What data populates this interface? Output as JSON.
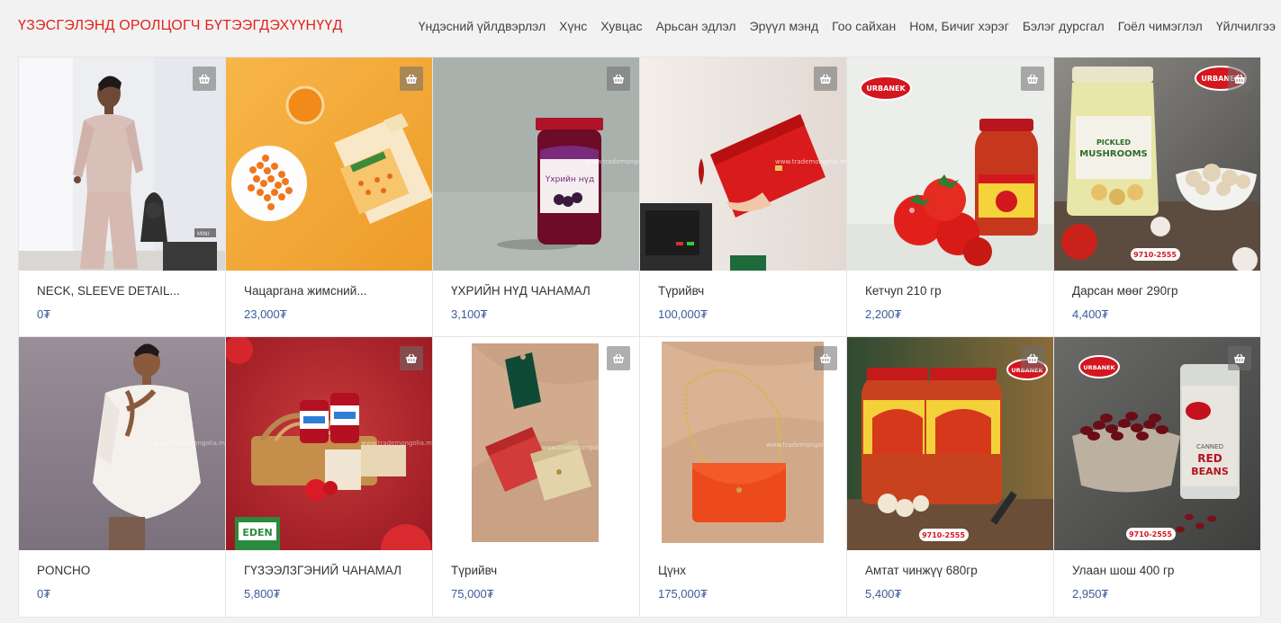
{
  "header": {
    "title": "ҮЗЭСГЭЛЭНД ОРОЛЦОГЧ БҮТЭЭГДЭХҮҮНҮҮД",
    "nav": [
      "Үндэсний үйлдвэрлэл",
      "Хүнс",
      "Хувцас",
      "Арьсан эдлэл",
      "Эрүүл мэнд",
      "Гоо сайхан",
      "Ном, Бичиг хэрэг",
      "Бэлэг дурсгал",
      "Гоёл чимэглэл",
      "Үйлчилгээ"
    ]
  },
  "currency": "₮",
  "products": [
    {
      "name": "NECK, SLEEVE DETAIL...",
      "price": "0₮"
    },
    {
      "name": "Чацаргана жимсний...",
      "price": "23,000₮"
    },
    {
      "name": "ҮХРИЙН НҮД ЧАНАМАЛ",
      "price": "3,100₮"
    },
    {
      "name": "Түрийвч",
      "price": "100,000₮"
    },
    {
      "name": " Кетчуп 210 гр",
      "price": "2,200₮"
    },
    {
      "name": "Дарсан мөөг 290гр",
      "price": "4,400₮"
    },
    {
      "name": "PONCHO",
      "price": "0₮"
    },
    {
      "name": "ГҮЗЭЭЛЗГЭНИЙ ЧАНАМАЛ",
      "price": "5,800₮"
    },
    {
      "name": "Түрийвч",
      "price": "75,000₮"
    },
    {
      "name": "Цүнх",
      "price": "175,000₮"
    },
    {
      "name": "Амтат чинжүү 680гр",
      "price": "5,400₮"
    },
    {
      "name": "Улаан шош 400 гр",
      "price": "2,950₮"
    }
  ],
  "image_text": {
    "urbanek": "URBANEK",
    "phone": "9710-2555",
    "eden": "EDEN",
    "mushroom_label_1": "PICKLED",
    "mushroom_label_2": "MUSHROOMS",
    "beans_label_1": "CANNED",
    "beans_label_2": "RED",
    "beans_label_3": "BEANS",
    "watermark": "www.trademongolia.mn",
    "jar_label": "Үхрийн нүд",
    "mini": "MINI"
  },
  "colors": {
    "brand_red": "#e2231a",
    "price_blue": "#3c5a9a"
  }
}
